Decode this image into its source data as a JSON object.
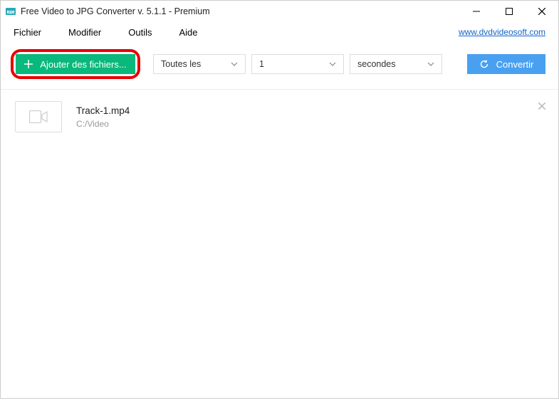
{
  "titlebar": {
    "app_title": "Free Video to JPG Converter v. 5.1.1 - Premium"
  },
  "menubar": {
    "file": "Fichier",
    "edit": "Modifier",
    "tools": "Outils",
    "help": "Aide",
    "link_text": "www.dvdvideosoft.com"
  },
  "toolbar": {
    "add_label": "Ajouter des fichiers...",
    "dropdown_mode": "Toutes les",
    "dropdown_count": "1",
    "dropdown_unit": "secondes",
    "convert_label": "Convertir"
  },
  "filelist": {
    "items": [
      {
        "name": "Track-1.mp4",
        "path": "C:/Video"
      }
    ]
  }
}
